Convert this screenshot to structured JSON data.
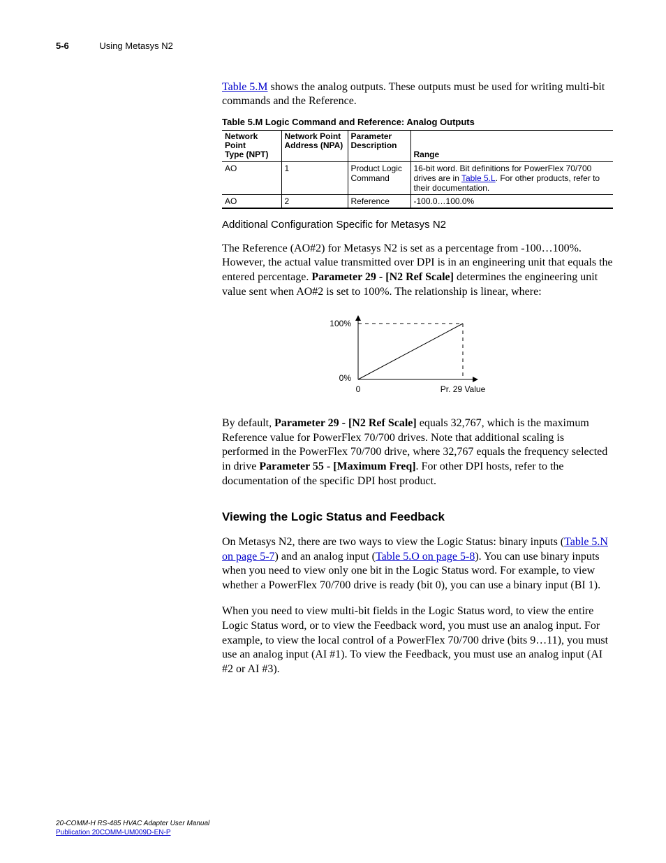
{
  "header": {
    "page_num": "5-6",
    "section": "Using Metasys N2"
  },
  "intro": {
    "link": "Table 5.M",
    "rest": " shows the analog outputs. These outputs must be used for writing multi-bit commands and the Reference."
  },
  "table": {
    "caption": "Table 5.M   Logic Command and Reference: Analog Outputs",
    "headers": {
      "c0a": "Network Point",
      "c0b": "Type (NPT)",
      "c1a": "Network Point",
      "c1b": "Address (NPA)",
      "c2a": "Parameter",
      "c2b": "Description",
      "c3": "Range"
    },
    "rows": [
      {
        "npt": "AO",
        "npa": "1",
        "desc": "Product Logic Command",
        "range_pre": "16-bit word. Bit definitions for PowerFlex 70/700 drives are in ",
        "range_link": "Table 5.L",
        "range_post": ". For other products, refer to their documentation."
      },
      {
        "npt": "AO",
        "npa": "2",
        "desc": "Reference",
        "range_pre": "-100.0…100.0%",
        "range_link": "",
        "range_post": ""
      }
    ]
  },
  "subhead": "Additional Configuration Specific for Metasys N2",
  "para1": {
    "a": "The Reference (AO#2) for Metasys N2 is set as a percentage from -100…100%. However, the actual value transmitted over DPI is in an engineering unit that equals the entered percentage. ",
    "b_bold": "Parameter 29 - [N2 Ref Scale]",
    "c": " determines the engineering unit value sent when AO#2 is set to 100%. The relationship is linear, where:"
  },
  "chart_data": {
    "type": "line",
    "x": [
      0,
      1
    ],
    "y": [
      0,
      100
    ],
    "y_ticks": [
      "0%",
      "100%"
    ],
    "x_ticks": [
      "0",
      "Pr. 29 Value"
    ],
    "xlabel": "",
    "ylabel": "",
    "xlim": [
      0,
      1
    ],
    "ylim": [
      0,
      100
    ]
  },
  "para2": {
    "a": "By default, ",
    "b_bold": "Parameter 29 - [N2 Ref Scale]",
    "c": " equals 32,767, which is the maximum Reference value for PowerFlex 70/700 drives. Note that additional scaling is performed in the PowerFlex 70/700 drive, where 32,767 equals the frequency selected in drive ",
    "d_bold": "Parameter 55 - [Maximum Freq]",
    "e": ". For other DPI hosts, refer to the documentation of the specific DPI host product."
  },
  "section_heading": "Viewing the Logic Status and Feedback",
  "para3": {
    "a": "On Metasys N2, there are two ways to view the Logic Status: binary inputs (",
    "link1": "Table 5.N on page 5-7",
    "b": ") and an analog input (",
    "link2": "Table 5.O on page 5-8",
    "c": "). You can use binary inputs when you need to view only one bit in the Logic Status word. For example, to view whether a PowerFlex 70/700 drive is ready (bit 0), you can use a binary input (BI 1)."
  },
  "para4": "When you need to view multi-bit fields in the Logic Status word, to view the entire Logic Status word, or to view the Feedback word, you must use an analog input. For example, to view the local control of a PowerFlex 70/700 drive (bits 9…11), you must use an analog input (AI #1). To view the Feedback, you must use an analog input (AI #2 or AI #3).",
  "footer": {
    "title": "20-COMM-H RS-485 HVAC Adapter User Manual",
    "pub": "Publication 20COMM-UM009D-EN-P"
  }
}
